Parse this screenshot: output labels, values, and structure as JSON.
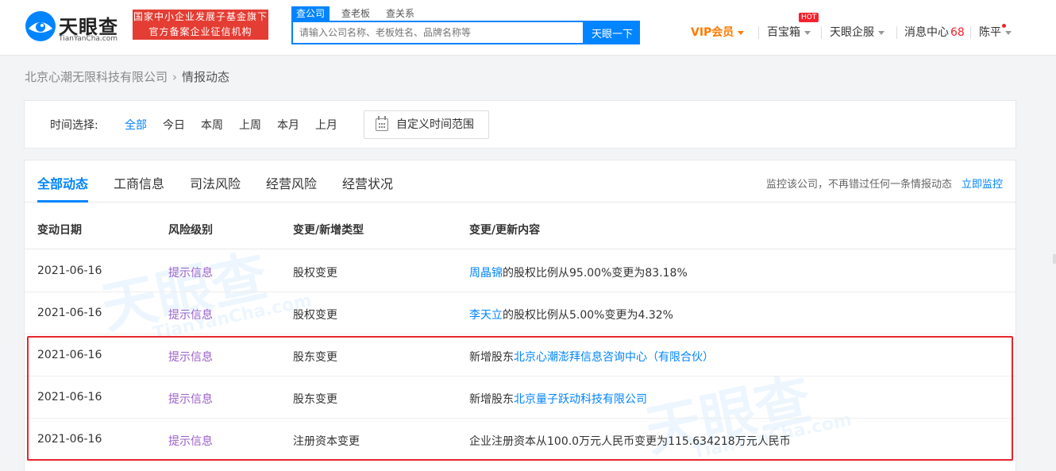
{
  "header": {
    "logo_text": "天眼查",
    "logo_sub": "TianYanCha.com",
    "slogan_line1": "国家中小企业发展子基金旗下",
    "slogan_line2": "官方备案企业征信机构",
    "search_tabs": [
      "查公司",
      "查老板",
      "查关系"
    ],
    "search_placeholder": "请输入公司名称、老板姓名、品牌名称等",
    "search_button": "天眼一下",
    "nav": {
      "vip": "VIP会员",
      "baibaoxiang": "百宝箱",
      "hot_badge": "HOT",
      "qiye": "天眼企服",
      "messages": "消息中心",
      "message_count": "68",
      "user": "陈平"
    }
  },
  "breadcrumb": {
    "company": "北京心潮无限科技有限公司",
    "arrow": "›",
    "current": "情报动态"
  },
  "time_filter": {
    "label": "时间选择:",
    "options": [
      "全部",
      "今日",
      "本周",
      "上周",
      "本月",
      "上月"
    ],
    "custom_range": "自定义时间范围"
  },
  "tabs": [
    "全部动态",
    "工商信息",
    "司法风险",
    "经营风险",
    "经营状况"
  ],
  "monitor": {
    "text": "监控该公司，不再错过任何一条情报动态",
    "link": "立即监控"
  },
  "table": {
    "headers": [
      "变动日期",
      "风险级别",
      "变更/新增类型",
      "变更/更新内容"
    ],
    "rows": [
      {
        "date": "2021-06-16",
        "risk": "提示信息",
        "type": "股权变更",
        "content_link": "周晶锦",
        "content_text": "的股权比例从95.00%变更为83.18%",
        "content_prefix": ""
      },
      {
        "date": "2021-06-16",
        "risk": "提示信息",
        "type": "股权变更",
        "content_link": "李天立",
        "content_text": "的股权比例从5.00%变更为4.32%",
        "content_prefix": ""
      },
      {
        "date": "2021-06-16",
        "risk": "提示信息",
        "type": "股东变更",
        "content_prefix": "新增股东",
        "content_link": "北京心潮澎拜信息咨询中心（有限合伙）",
        "content_text": ""
      },
      {
        "date": "2021-06-16",
        "risk": "提示信息",
        "type": "股东变更",
        "content_prefix": "新增股东",
        "content_link": "北京量子跃动科技有限公司",
        "content_text": ""
      },
      {
        "date": "2021-06-16",
        "risk": "提示信息",
        "type": "注册资本变更",
        "content_prefix": "企业注册资本从100.0万元人民币变更为115.634218万元人民币",
        "content_link": "",
        "content_text": ""
      }
    ]
  },
  "watermark": {
    "text": "天眼查",
    "sub": "TianYanCha.com"
  },
  "colors": {
    "accent": "#0084ff",
    "risk": "#9a60c9",
    "highlight": "#e8252b",
    "slogan_bg": "#e43d33",
    "vip": "#ff7a00"
  }
}
